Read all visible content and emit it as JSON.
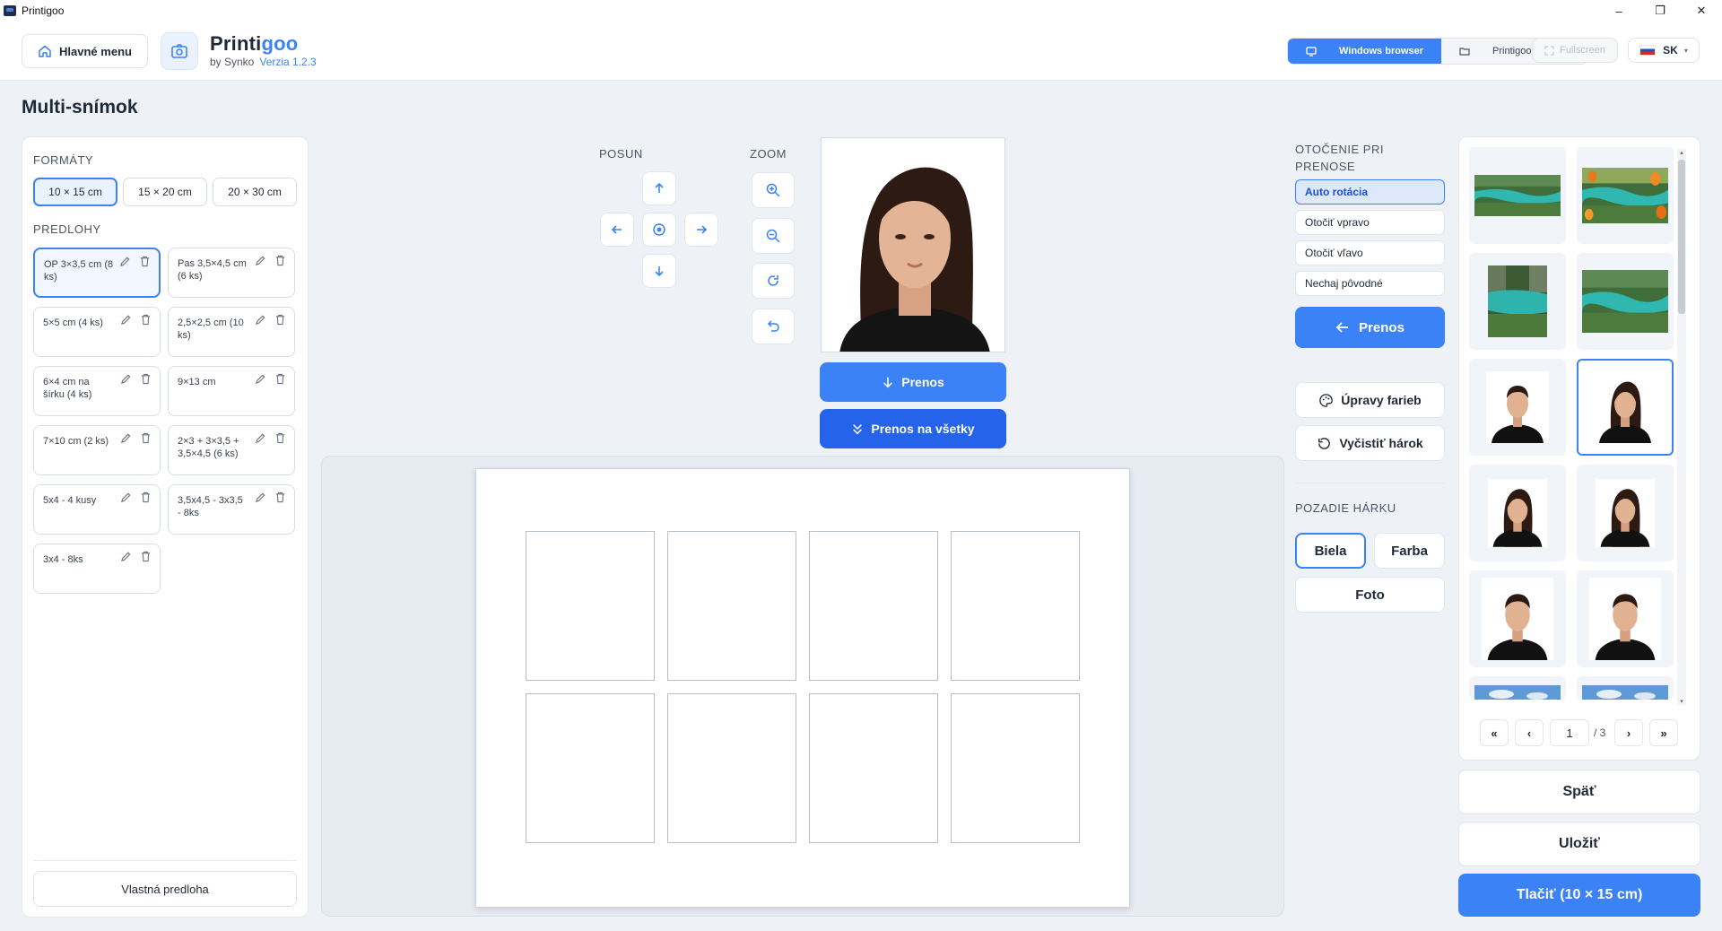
{
  "window": {
    "title": "Printigoo",
    "minimize": "–",
    "maximize": "❐",
    "close": "✕"
  },
  "header": {
    "main_menu": "Hlavné menu",
    "logo_name_a": "Printi",
    "logo_name_b": "goo",
    "logo_by": "by Synko",
    "logo_version": "Verzia 1.2.3",
    "browser_windows": "Windows browser",
    "browser_printigoo": "Printigoo browser",
    "fullscreen": "Fullscreen",
    "language": "SK"
  },
  "page_title": "Multi-snímok",
  "left": {
    "formats_label": "FORMÁTY",
    "formats": [
      "10 × 15 cm",
      "15 × 20 cm",
      "20 × 30 cm"
    ],
    "templates_label": "PREDLOHY",
    "templates": [
      "OP 3×3,5 cm (8 ks)",
      "Pas 3,5×4,5 cm (6 ks)",
      "5×5 cm (4 ks)",
      "2,5×2,5 cm (10 ks)",
      "6×4 cm na šírku (4 ks)",
      "9×13 cm",
      "7×10 cm (2 ks)",
      "2×3 + 3×3,5 + 3,5×4,5 (6 ks)",
      "5x4 - 4 kusy",
      "3,5x4,5 - 3x3,5 - 8ks",
      "3x4 - 8ks"
    ],
    "custom_template": "Vlastná predloha"
  },
  "controls": {
    "move_label": "POSUN",
    "zoom_label": "ZOOM",
    "transfer": "Prenos",
    "transfer_all": "Prenos na všetky"
  },
  "right": {
    "rotation_label_1": "OTOČENIE PRI",
    "rotation_label_2": "PRENOSE",
    "rotation_options": [
      "Auto rotácia",
      "Otočiť vpravo",
      "Otočiť vľavo",
      "Nechaj pôvodné"
    ],
    "transfer": "Prenos",
    "color_edits": "Úpravy farieb",
    "clear_sheet": "Vyčistiť hárok",
    "background_label": "POZADIE HÁRKU",
    "bg_white": "Biela",
    "bg_color": "Farba",
    "bg_photo": "Foto"
  },
  "gallery": {
    "page_first": "«",
    "page_prev": "‹",
    "page_current": "1",
    "page_total": "/ 3",
    "page_next": "›",
    "page_last": "»"
  },
  "footer": {
    "back": "Späť",
    "save": "Uložiť",
    "print": "Tlačiť (10 × 15 cm)"
  },
  "colors": {
    "accent": "#3b82f6",
    "accent_dark": "#2563eb"
  }
}
